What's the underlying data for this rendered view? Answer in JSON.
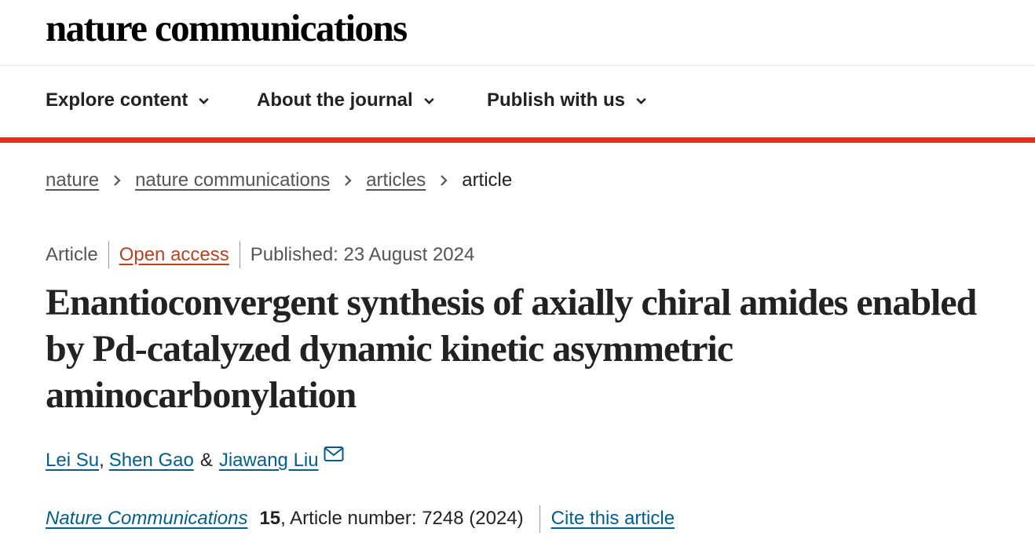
{
  "site": {
    "logo_text": "nature communications"
  },
  "nav": {
    "items": [
      {
        "label": "Explore content",
        "icon": "chevron-down-icon"
      },
      {
        "label": "About the journal",
        "icon": "chevron-down-icon"
      },
      {
        "label": "Publish with us",
        "icon": "chevron-down-icon"
      }
    ]
  },
  "breadcrumb": {
    "items": [
      "nature",
      "nature communications",
      "articles"
    ],
    "current": "article"
  },
  "article": {
    "type": "Article",
    "access": "Open access",
    "published": "Published: 23 August 2024",
    "title": "Enantioconvergent synthesis of axially chiral amides enabled by Pd-catalyzed dynamic kinetic asymmetric aminocarbonylation",
    "authors": [
      "Lei Su",
      "Shen Gao",
      "Jiawang Liu"
    ],
    "author_sep_1": ",",
    "author_sep_2": "&",
    "journal": "Nature Communications",
    "volume": "15",
    "article_number": ", Article number: 7248 (2024)",
    "cite_label": "Cite this article"
  },
  "colors": {
    "accent_red": "#e0321f",
    "link_blue": "#025e8d",
    "open_access": "#b44426"
  }
}
